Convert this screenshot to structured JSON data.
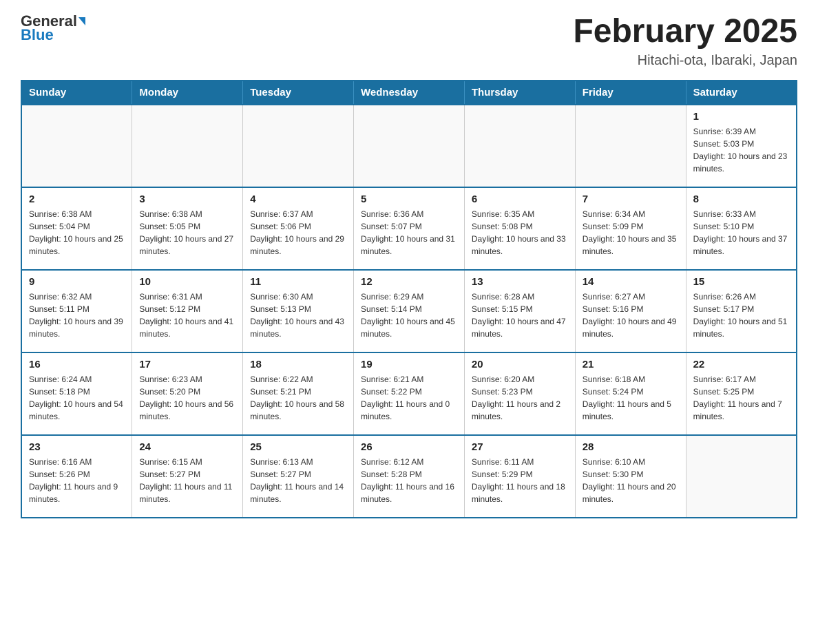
{
  "header": {
    "logo_general": "General",
    "logo_blue": "Blue",
    "month_title": "February 2025",
    "location": "Hitachi-ota, Ibaraki, Japan"
  },
  "calendar": {
    "days_of_week": [
      "Sunday",
      "Monday",
      "Tuesday",
      "Wednesday",
      "Thursday",
      "Friday",
      "Saturday"
    ],
    "weeks": [
      [
        {
          "day": "",
          "info": ""
        },
        {
          "day": "",
          "info": ""
        },
        {
          "day": "",
          "info": ""
        },
        {
          "day": "",
          "info": ""
        },
        {
          "day": "",
          "info": ""
        },
        {
          "day": "",
          "info": ""
        },
        {
          "day": "1",
          "info": "Sunrise: 6:39 AM\nSunset: 5:03 PM\nDaylight: 10 hours and 23 minutes."
        }
      ],
      [
        {
          "day": "2",
          "info": "Sunrise: 6:38 AM\nSunset: 5:04 PM\nDaylight: 10 hours and 25 minutes."
        },
        {
          "day": "3",
          "info": "Sunrise: 6:38 AM\nSunset: 5:05 PM\nDaylight: 10 hours and 27 minutes."
        },
        {
          "day": "4",
          "info": "Sunrise: 6:37 AM\nSunset: 5:06 PM\nDaylight: 10 hours and 29 minutes."
        },
        {
          "day": "5",
          "info": "Sunrise: 6:36 AM\nSunset: 5:07 PM\nDaylight: 10 hours and 31 minutes."
        },
        {
          "day": "6",
          "info": "Sunrise: 6:35 AM\nSunset: 5:08 PM\nDaylight: 10 hours and 33 minutes."
        },
        {
          "day": "7",
          "info": "Sunrise: 6:34 AM\nSunset: 5:09 PM\nDaylight: 10 hours and 35 minutes."
        },
        {
          "day": "8",
          "info": "Sunrise: 6:33 AM\nSunset: 5:10 PM\nDaylight: 10 hours and 37 minutes."
        }
      ],
      [
        {
          "day": "9",
          "info": "Sunrise: 6:32 AM\nSunset: 5:11 PM\nDaylight: 10 hours and 39 minutes."
        },
        {
          "day": "10",
          "info": "Sunrise: 6:31 AM\nSunset: 5:12 PM\nDaylight: 10 hours and 41 minutes."
        },
        {
          "day": "11",
          "info": "Sunrise: 6:30 AM\nSunset: 5:13 PM\nDaylight: 10 hours and 43 minutes."
        },
        {
          "day": "12",
          "info": "Sunrise: 6:29 AM\nSunset: 5:14 PM\nDaylight: 10 hours and 45 minutes."
        },
        {
          "day": "13",
          "info": "Sunrise: 6:28 AM\nSunset: 5:15 PM\nDaylight: 10 hours and 47 minutes."
        },
        {
          "day": "14",
          "info": "Sunrise: 6:27 AM\nSunset: 5:16 PM\nDaylight: 10 hours and 49 minutes."
        },
        {
          "day": "15",
          "info": "Sunrise: 6:26 AM\nSunset: 5:17 PM\nDaylight: 10 hours and 51 minutes."
        }
      ],
      [
        {
          "day": "16",
          "info": "Sunrise: 6:24 AM\nSunset: 5:18 PM\nDaylight: 10 hours and 54 minutes."
        },
        {
          "day": "17",
          "info": "Sunrise: 6:23 AM\nSunset: 5:20 PM\nDaylight: 10 hours and 56 minutes."
        },
        {
          "day": "18",
          "info": "Sunrise: 6:22 AM\nSunset: 5:21 PM\nDaylight: 10 hours and 58 minutes."
        },
        {
          "day": "19",
          "info": "Sunrise: 6:21 AM\nSunset: 5:22 PM\nDaylight: 11 hours and 0 minutes."
        },
        {
          "day": "20",
          "info": "Sunrise: 6:20 AM\nSunset: 5:23 PM\nDaylight: 11 hours and 2 minutes."
        },
        {
          "day": "21",
          "info": "Sunrise: 6:18 AM\nSunset: 5:24 PM\nDaylight: 11 hours and 5 minutes."
        },
        {
          "day": "22",
          "info": "Sunrise: 6:17 AM\nSunset: 5:25 PM\nDaylight: 11 hours and 7 minutes."
        }
      ],
      [
        {
          "day": "23",
          "info": "Sunrise: 6:16 AM\nSunset: 5:26 PM\nDaylight: 11 hours and 9 minutes."
        },
        {
          "day": "24",
          "info": "Sunrise: 6:15 AM\nSunset: 5:27 PM\nDaylight: 11 hours and 11 minutes."
        },
        {
          "day": "25",
          "info": "Sunrise: 6:13 AM\nSunset: 5:27 PM\nDaylight: 11 hours and 14 minutes."
        },
        {
          "day": "26",
          "info": "Sunrise: 6:12 AM\nSunset: 5:28 PM\nDaylight: 11 hours and 16 minutes."
        },
        {
          "day": "27",
          "info": "Sunrise: 6:11 AM\nSunset: 5:29 PM\nDaylight: 11 hours and 18 minutes."
        },
        {
          "day": "28",
          "info": "Sunrise: 6:10 AM\nSunset: 5:30 PM\nDaylight: 11 hours and 20 minutes."
        },
        {
          "day": "",
          "info": ""
        }
      ]
    ]
  }
}
